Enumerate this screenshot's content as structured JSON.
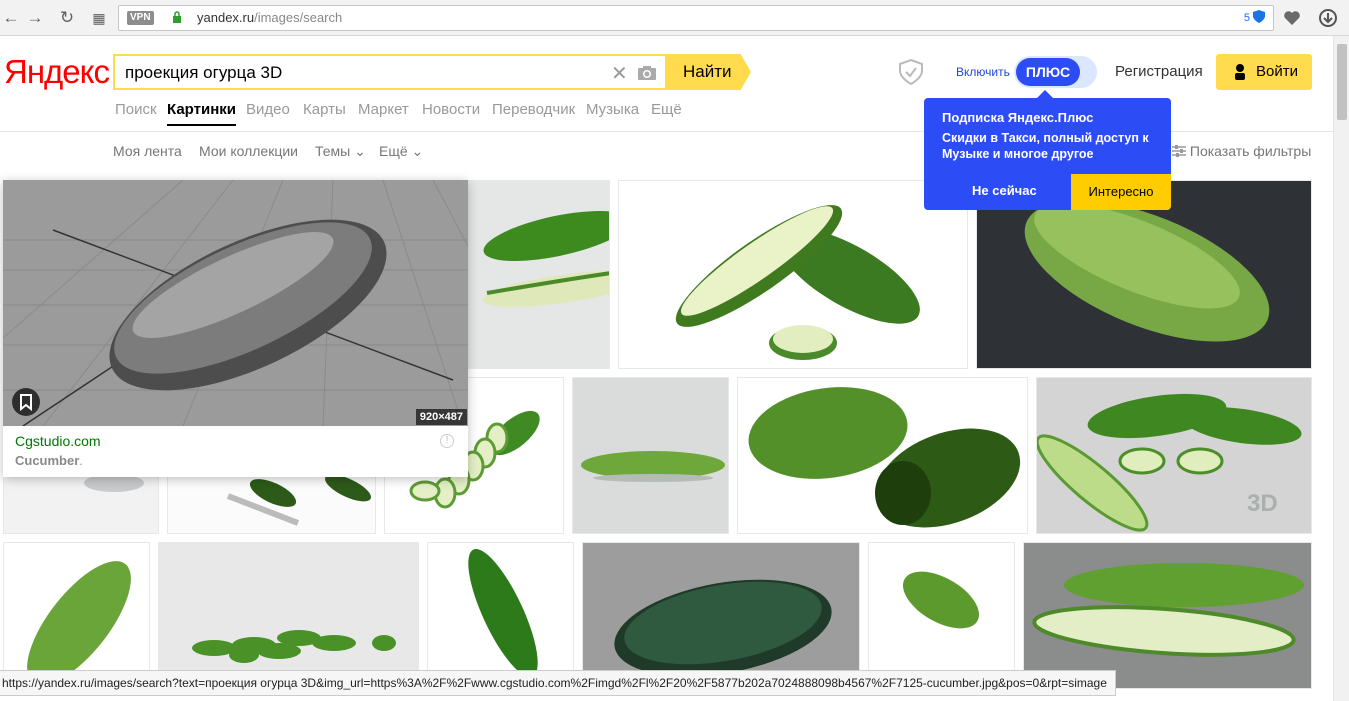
{
  "browser": {
    "vpn_label": "VPN",
    "url_host": "yandex.ru",
    "url_path": "/images/search",
    "badge_count": "5"
  },
  "header": {
    "logo": "Яндекс",
    "search_query": "проекция огурца 3D",
    "search_button": "Найти",
    "enable_label": "Включить",
    "plus_label": "ПЛЮС",
    "register": "Регистрация",
    "login": "Войти"
  },
  "tabs": [
    {
      "label": "Поиск"
    },
    {
      "label": "Картинки",
      "active": true
    },
    {
      "label": "Видео"
    },
    {
      "label": "Карты"
    },
    {
      "label": "Маркет"
    },
    {
      "label": "Новости"
    },
    {
      "label": "Переводчик"
    },
    {
      "label": "Музыка"
    },
    {
      "label": "Ещё"
    }
  ],
  "subtabs": [
    {
      "label": "Моя лента"
    },
    {
      "label": "Мои коллекции"
    },
    {
      "label": "Темы ⌄"
    },
    {
      "label": "Ещё ⌄"
    }
  ],
  "filters": "Показать фильтры",
  "popup": {
    "title": "Подписка Яндекс.Плюс",
    "text": "Скидки в Такси, полный доступ к Музыке и многое другое",
    "dismiss": "Не сейчас",
    "accept": "Интересно"
  },
  "hover_card": {
    "size": "920×487",
    "site": "Cgstudio.com",
    "title": "Cucumber",
    "title_suffix": "."
  },
  "tile_badge": "3D",
  "status_url": "https://yandex.ru/images/search?text=проекция огурца 3D&img_url=https%3A%2F%2Fwww.cgstudio.com%2Fimgd%2Fl%2F20%2F5877b202a7024888098b4567%2F7125-cucumber.jpg&pos=0&rpt=simage"
}
